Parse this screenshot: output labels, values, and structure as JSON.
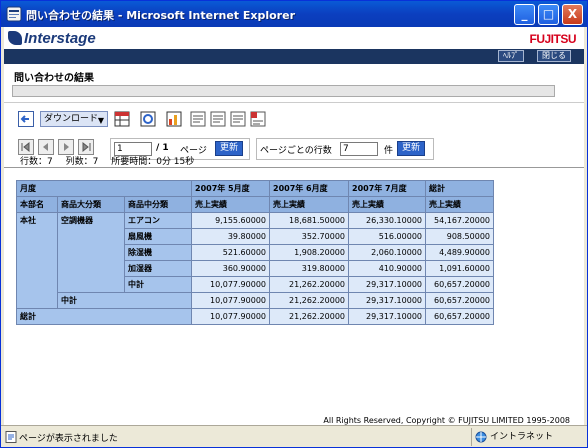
{
  "window": {
    "title": "問い合わせの結果 - Microsoft Internet Explorer",
    "minimize": "_",
    "maximize": "□",
    "close": "X"
  },
  "brand": {
    "logo": "Interstage",
    "vendor": "FUJITSU"
  },
  "nav": {
    "help": "ﾍﾙﾌﾟ",
    "close": "閉じる"
  },
  "page": {
    "title": "問い合わせの結果"
  },
  "toolbar": {
    "download": "ダウンロード",
    "icons": [
      "back-icon",
      "table-view-icon",
      "report-icon",
      "chart-icon",
      "print-icon",
      "export-icon",
      "copy-icon",
      "delete-icon"
    ]
  },
  "paging": {
    "page_input": "1",
    "page_total": "/ 1",
    "page_label": "ページ",
    "update1": "更新",
    "rows_per_page_label": "ページごとの行数",
    "rows_per_page_input": "7",
    "rows_unit": "件",
    "update2": "更新"
  },
  "stats": {
    "rows": "行数：7",
    "cols": "列数：7",
    "elapsed": "所要時間：0分 15秒"
  },
  "table": {
    "month_header": "月度",
    "col_headers": [
      "本部名",
      "商品大分類",
      "商品中分類"
    ],
    "months": [
      "2007年 5月度",
      "2007年 6月度",
      "2007年 7月度",
      "総計"
    ],
    "measure": "売上実績",
    "dept": "本社",
    "category": "空調機器",
    "rows": [
      {
        "name": "エアコン",
        "values": [
          "9,155.60000",
          "18,681.50000",
          "26,330.10000",
          "54,167.20000"
        ]
      },
      {
        "name": "扇風機",
        "values": [
          "39.80000",
          "352.70000",
          "516.00000",
          "908.50000"
        ]
      },
      {
        "name": "除湿機",
        "values": [
          "521.60000",
          "1,908.20000",
          "2,060.10000",
          "4,489.90000"
        ]
      },
      {
        "name": "加湿器",
        "values": [
          "360.90000",
          "319.80000",
          "410.90000",
          "1,091.60000"
        ]
      },
      {
        "name": "中計",
        "values": [
          "10,077.90000",
          "21,262.20000",
          "29,317.10000",
          "60,657.20000"
        ]
      }
    ],
    "subtotal": {
      "name": "中計",
      "values": [
        "10,077.90000",
        "21,262.20000",
        "29,317.10000",
        "60,657.20000"
      ]
    },
    "total": {
      "name": "総計",
      "values": [
        "10,077.90000",
        "21,262.20000",
        "29,317.10000",
        "60,657.20000"
      ]
    }
  },
  "footer": {
    "copyright": "All Rights Reserved, Copyright © FUJITSU LIMITED 1995-2008"
  },
  "status": {
    "message": "ページが表示されました",
    "zone": "イントラネット"
  }
}
